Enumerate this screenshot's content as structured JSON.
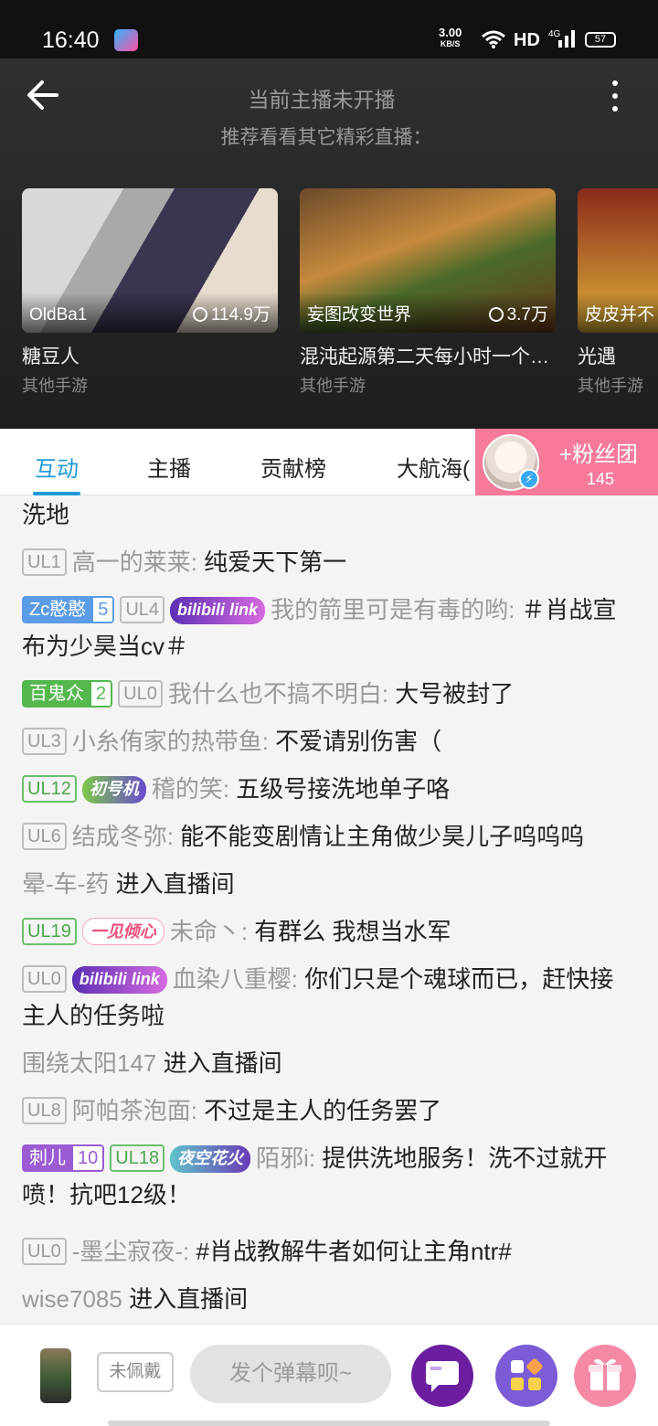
{
  "status_bar": {
    "time": "16:40",
    "net_speed_value": "3.00",
    "net_speed_unit": "KB/S",
    "hd_label": "HD",
    "network_label": "4G",
    "battery": "57"
  },
  "player": {
    "offline_title": "当前主播未开播",
    "offline_subtitle": "推荐看看其它精彩直播：",
    "recommendations": [
      {
        "anchor": "OldBa1",
        "views": "114.9万",
        "title": "糖豆人",
        "category": "其他手游"
      },
      {
        "anchor": "妄图改变世界",
        "views": "3.7万",
        "title": "混沌起源第二天每小时一个…",
        "category": "其他手游"
      },
      {
        "anchor": "皮皮并不",
        "views": "",
        "title": "光遇",
        "category": "其他手游"
      }
    ]
  },
  "tabs": [
    "互动",
    "主播",
    "贡献榜",
    "大航海("
  ],
  "fan_club": {
    "label": "+粉丝团",
    "count": "145"
  },
  "chat": {
    "partial_top": "洗地",
    "messages": [
      {
        "level": "UL1",
        "user": "高一的莱莱:",
        "text": "纯爱天下第一"
      },
      {
        "medal_name": "Zc憨憨",
        "medal_level": "5",
        "level": "UL4",
        "title_badge": "bilibili link",
        "user": "我的箭里可是有毒的哟:",
        "text": "＃肖战宣布为少昊当cv＃"
      },
      {
        "medal_name": "百鬼众",
        "medal_level": "2",
        "level": "UL0",
        "user": "我什么也不搞不明白:",
        "text": "大号被封了"
      },
      {
        "level": "UL3",
        "user": "小糸侑家的热带鱼:",
        "text": "不爱请别伤害（"
      },
      {
        "level": "UL12",
        "title_badge": "初号机",
        "user": "稽的笑:",
        "text": "五级号接洗地单子咯"
      },
      {
        "level": "UL6",
        "user": "结成冬弥:",
        "text": "能不能变剧情让主角做少昊儿子呜呜呜"
      },
      {
        "user": "晕-车-药",
        "text": "进入直播间"
      },
      {
        "level": "UL19",
        "title_badge": "一见倾心",
        "user": "未命丶:",
        "text": "有群么 我想当水军"
      },
      {
        "level": "UL0",
        "title_badge": "bilibili link",
        "user": "血染八重樱:",
        "text": "你们只是个魂球而已，赶快接主人的任务啦"
      },
      {
        "user": "围绕太阳147",
        "text": "进入直播间"
      },
      {
        "level": "UL8",
        "user": "阿帕茶泡面:",
        "text": "不过是主人的任务罢了"
      },
      {
        "medal_name": "刺儿",
        "medal_level": "10",
        "level": "UL18",
        "title_badge": "夜空花火",
        "user": "陌邪i:",
        "text": "提供洗地服务！洗不过就开喷！抗吧12级！"
      },
      {
        "level": "UL0",
        "user": "-墨尘寂夜-:",
        "text": "#肖战教解牛者如何让主角ntr#"
      },
      {
        "user": "wise7085",
        "text": "进入直播间"
      }
    ]
  },
  "bottom_bar": {
    "not_wearing_label": "未佩戴",
    "danmaku_placeholder": "发个弹幕呗~",
    "colors": {
      "chat_btn": "#6b1fa0",
      "interact_btn": "#7b5bd6",
      "gift_btn": "#f68aa6"
    }
  }
}
